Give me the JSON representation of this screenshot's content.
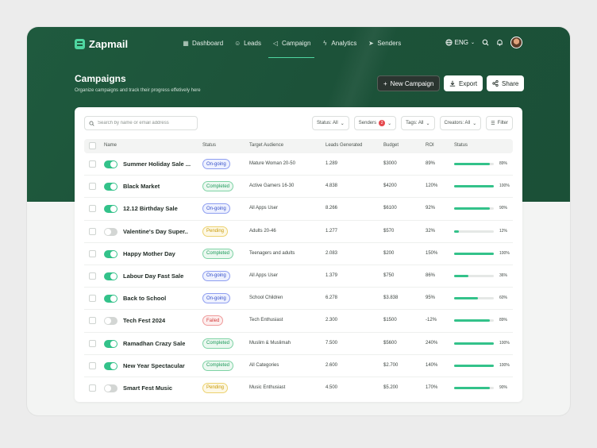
{
  "app": {
    "name": "Zapmail"
  },
  "nav": {
    "items": [
      {
        "label": "Dashboard",
        "icon": "grid-icon"
      },
      {
        "label": "Leads",
        "icon": "users-icon"
      },
      {
        "label": "Campaign",
        "icon": "megaphone-icon",
        "active": true
      },
      {
        "label": "Analytics",
        "icon": "lightning-icon"
      },
      {
        "label": "Senders",
        "icon": "send-icon"
      }
    ],
    "language": "ENG"
  },
  "header": {
    "title": "Campaigns",
    "subtitle": "Organize campaigns and track their progress effetively here",
    "new_campaign_label": "New Campaign",
    "export_label": "Export",
    "share_label": "Share"
  },
  "toolbar": {
    "search_placeholder": "Search by name or email address",
    "status_filter": "Status: All",
    "senders_filter": "Senders",
    "senders_count": "2",
    "tags_filter": "Tags: All",
    "creators_filter": "Creators: All",
    "filter_label": "Filter"
  },
  "table": {
    "columns": [
      "Name",
      "Status",
      "Target Audience",
      "Leads Generated",
      "Budget",
      "ROI",
      "Status"
    ],
    "rows": [
      {
        "name": "Summer Holiday Sale ...",
        "active": true,
        "status": "On-going",
        "status_type": "ongoing",
        "audience": "Mature Woman 20-50",
        "leads": "1.289",
        "budget": "$3000",
        "roi": "89%",
        "progress": 89,
        "progress_label": "89%"
      },
      {
        "name": "Black Market",
        "active": true,
        "status": "Completed",
        "status_type": "completed",
        "audience": "Active Gamers 16-30",
        "leads": "4.838",
        "budget": "$4200",
        "roi": "120%",
        "progress": 100,
        "progress_label": "100%"
      },
      {
        "name": "12.12 Birthday Sale",
        "active": true,
        "status": "On-going",
        "status_type": "ongoing",
        "audience": "All Apps User",
        "leads": "8.266",
        "budget": "$6100",
        "roi": "92%",
        "progress": 90,
        "progress_label": "90%"
      },
      {
        "name": "Valentine's Day Super..",
        "active": false,
        "status": "Pending",
        "status_type": "pending",
        "audience": "Adults 20-46",
        "leads": "1.277",
        "budget": "$570",
        "roi": "32%",
        "progress": 12,
        "progress_label": "12%"
      },
      {
        "name": "Happy Mother Day",
        "active": true,
        "status": "Completed",
        "status_type": "completed",
        "audience": "Teenagers and adults",
        "leads": "2.083",
        "budget": "$200",
        "roi": "150%",
        "progress": 100,
        "progress_label": "100%"
      },
      {
        "name": "Labour Day Fast Sale",
        "active": true,
        "status": "On-going",
        "status_type": "ongoing",
        "audience": "All Apps User",
        "leads": "1.379",
        "budget": "$750",
        "roi": "86%",
        "progress": 36,
        "progress_label": "36%"
      },
      {
        "name": "Back to School",
        "active": true,
        "status": "On-going",
        "status_type": "ongoing",
        "audience": "School Children",
        "leads": "6.278",
        "budget": "$3.838",
        "roi": "95%",
        "progress": 60,
        "progress_label": "60%"
      },
      {
        "name": "Tech Fest 2024",
        "active": false,
        "status": "Failed",
        "status_type": "failed",
        "audience": "Tech Enthusiast",
        "leads": "2.300",
        "budget": "$1500",
        "roi": "-12%",
        "progress": 89,
        "progress_label": "89%"
      },
      {
        "name": "Ramadhan Crazy Sale",
        "active": true,
        "status": "Completed",
        "status_type": "completed",
        "audience": "Muslim & Muslimah",
        "leads": "7.500",
        "budget": "$5600",
        "roi": "240%",
        "progress": 100,
        "progress_label": "100%"
      },
      {
        "name": "New Year Spectacular",
        "active": true,
        "status": "Completed",
        "status_type": "completed",
        "audience": "All Categories",
        "leads": "2.600",
        "budget": "$2.700",
        "roi": "140%",
        "progress": 100,
        "progress_label": "100%"
      },
      {
        "name": "Smart Fest Music",
        "active": false,
        "status": "Pending",
        "status_type": "pending",
        "audience": "Music Enthusiast",
        "leads": "4.500",
        "budget": "$5.200",
        "roi": "170%",
        "progress": 90,
        "progress_label": "90%"
      }
    ]
  }
}
